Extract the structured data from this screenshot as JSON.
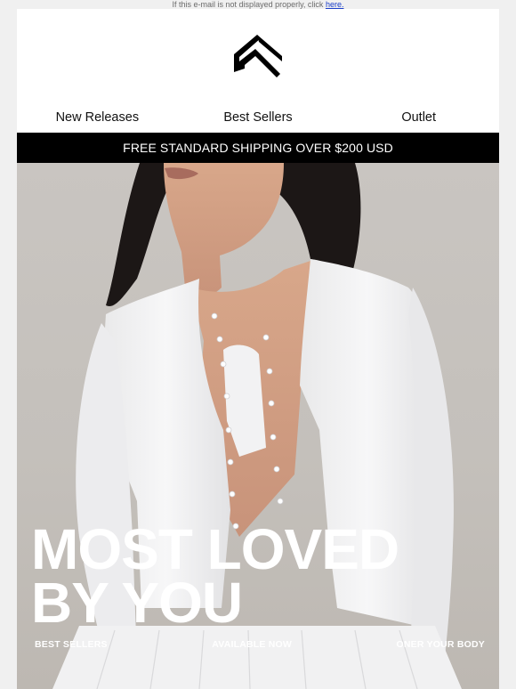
{
  "preheader": {
    "text": "If this e-mail is not displayed properly, click ",
    "link_label": "here."
  },
  "logo": {
    "icon": "chevron-logo-icon"
  },
  "nav": {
    "items": [
      {
        "label": "New Releases"
      },
      {
        "label": "Best Sellers"
      },
      {
        "label": "Outlet"
      }
    ]
  },
  "shipping_banner": {
    "text": "FREE STANDARD SHIPPING OVER $200 USD"
  },
  "hero": {
    "headline_line1": "MOST LOVED",
    "headline_line2": "BY YOU",
    "links": [
      {
        "label": "BEST SELLERS"
      },
      {
        "label": "AVAILABLE NOW"
      },
      {
        "label": "ONER YOUR BODY"
      }
    ]
  },
  "colors": {
    "banner_bg": "#000000",
    "banner_text": "#ffffff",
    "link": "#1a3ec8",
    "hero_bg": "#c6c2bd"
  }
}
